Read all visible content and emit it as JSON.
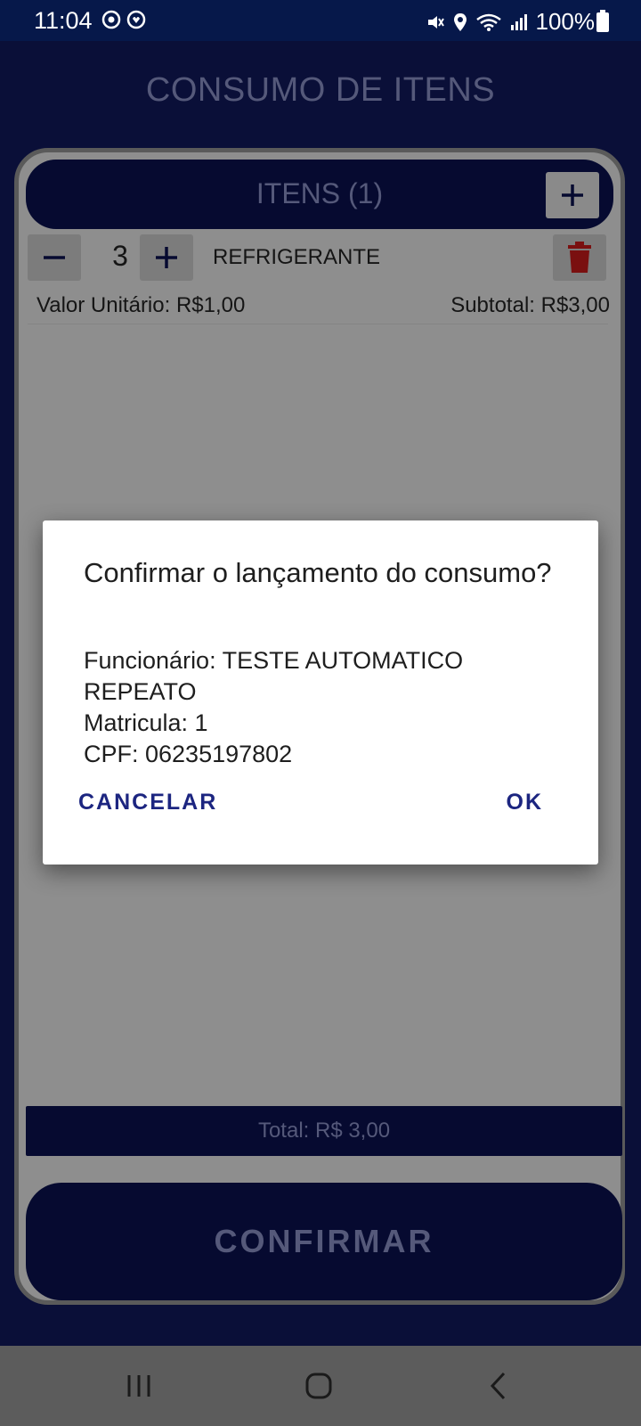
{
  "status_bar": {
    "time": "11:04",
    "battery": "100%",
    "icons": [
      "sync-icon",
      "heart-monitor-icon",
      "mute-icon",
      "location-icon",
      "wifi-icon",
      "signal-icon",
      "battery-icon"
    ]
  },
  "page": {
    "title": "CONSUMO DE ITENS"
  },
  "items_panel": {
    "header": "ITENS (1)",
    "items": [
      {
        "quantity": "3",
        "name": "REFRIGERANTE",
        "unit_value_label": "Valor Unitário: R$1,00",
        "subtotal_label": "Subtotal: R$3,00"
      }
    ]
  },
  "total": {
    "label": "Total: R$ 3,00"
  },
  "confirm_button": {
    "label": "CONFIRMAR"
  },
  "dialog": {
    "title": "Confirmar o lançamento do consumo?",
    "lines": [
      "Funcionário: TESTE AUTOMATICO REPEATO",
      "Matricula: 1",
      "CPF: 06235197802"
    ],
    "cancel_label": "CANCELAR",
    "ok_label": "OK"
  },
  "colors": {
    "app_background": "#0a0f38",
    "status_bar": "#06184a",
    "dialog_button_text": "#1c2580",
    "delete_icon": "#7a1010"
  }
}
